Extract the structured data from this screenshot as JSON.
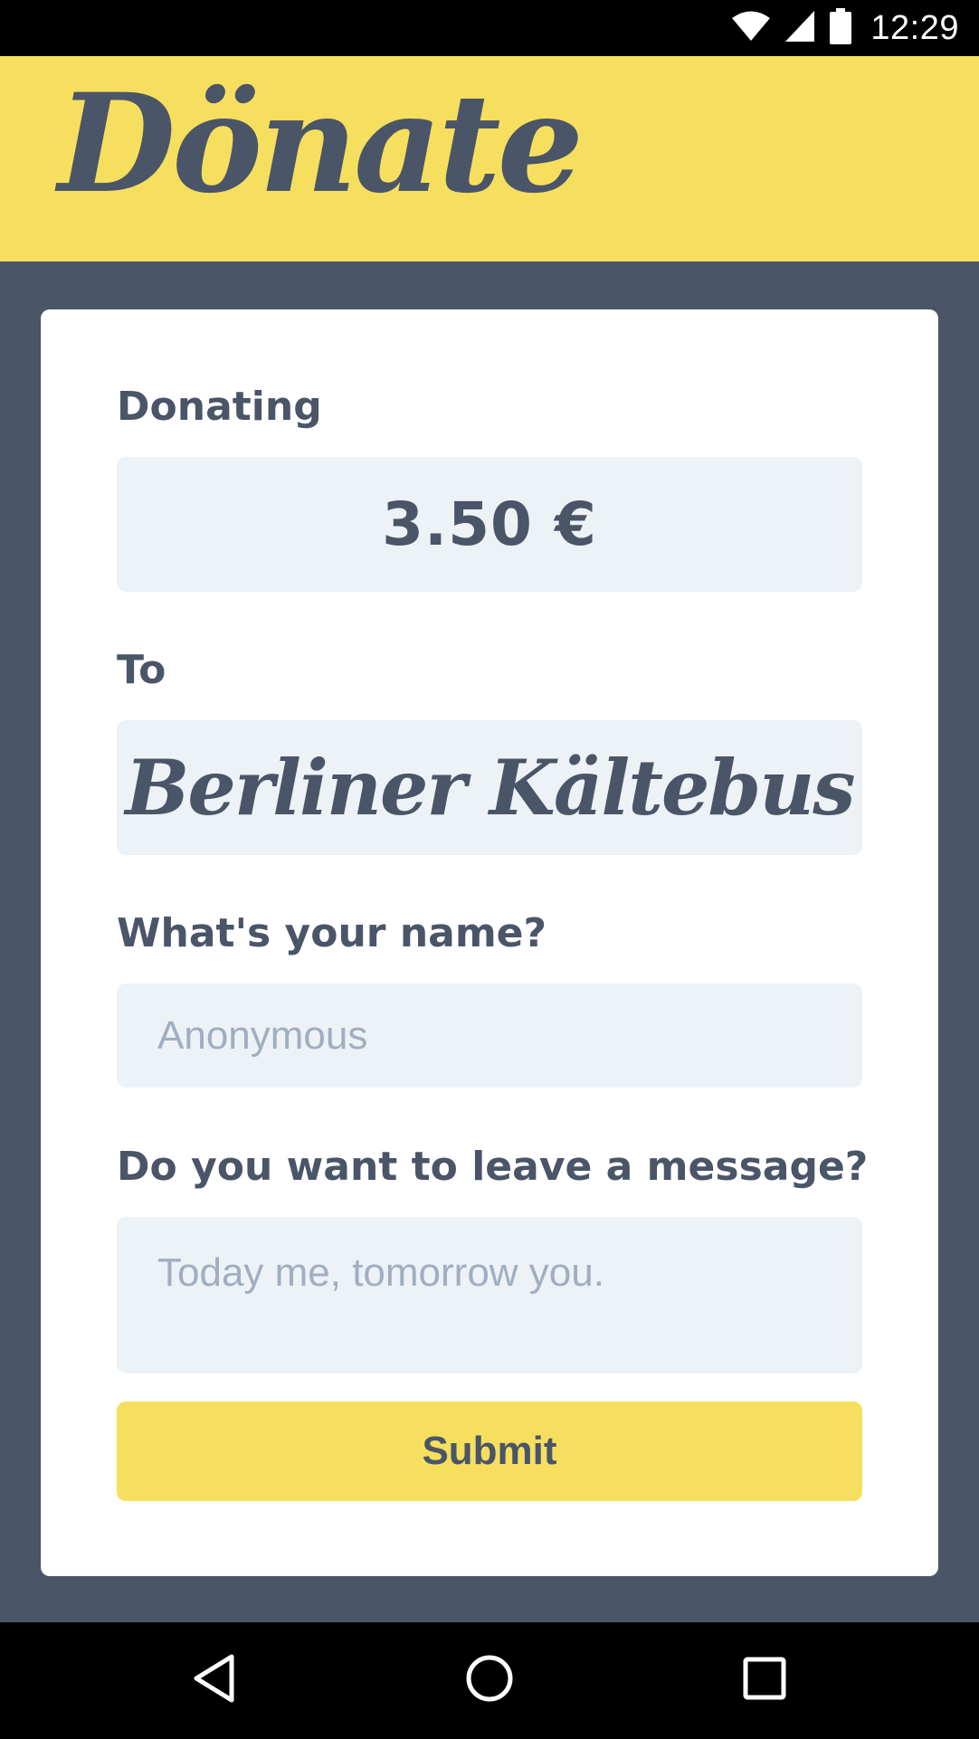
{
  "status_bar": {
    "time": "12:29",
    "icons": [
      "wifi-icon",
      "cell-signal-icon",
      "battery-icon"
    ]
  },
  "header": {
    "logo_text": "Dönate"
  },
  "form": {
    "donating_label": "Donating",
    "amount": "3.50 €",
    "to_label": "To",
    "recipient": "Berliner Kältebus",
    "name_label": "What's your name?",
    "name_placeholder": "Anonymous",
    "name_value": "",
    "message_label": "Do you want to leave a message?",
    "message_placeholder": "Today me, tomorrow you.",
    "message_value": "",
    "submit_label": "Submit"
  },
  "nav_bar": {
    "buttons": [
      "back-icon",
      "home-icon",
      "recents-icon"
    ]
  },
  "colors": {
    "accent_yellow": "#f6df5e",
    "slate": "#4a5568",
    "input_bg": "#edf2f7",
    "placeholder": "#a0aec0"
  }
}
